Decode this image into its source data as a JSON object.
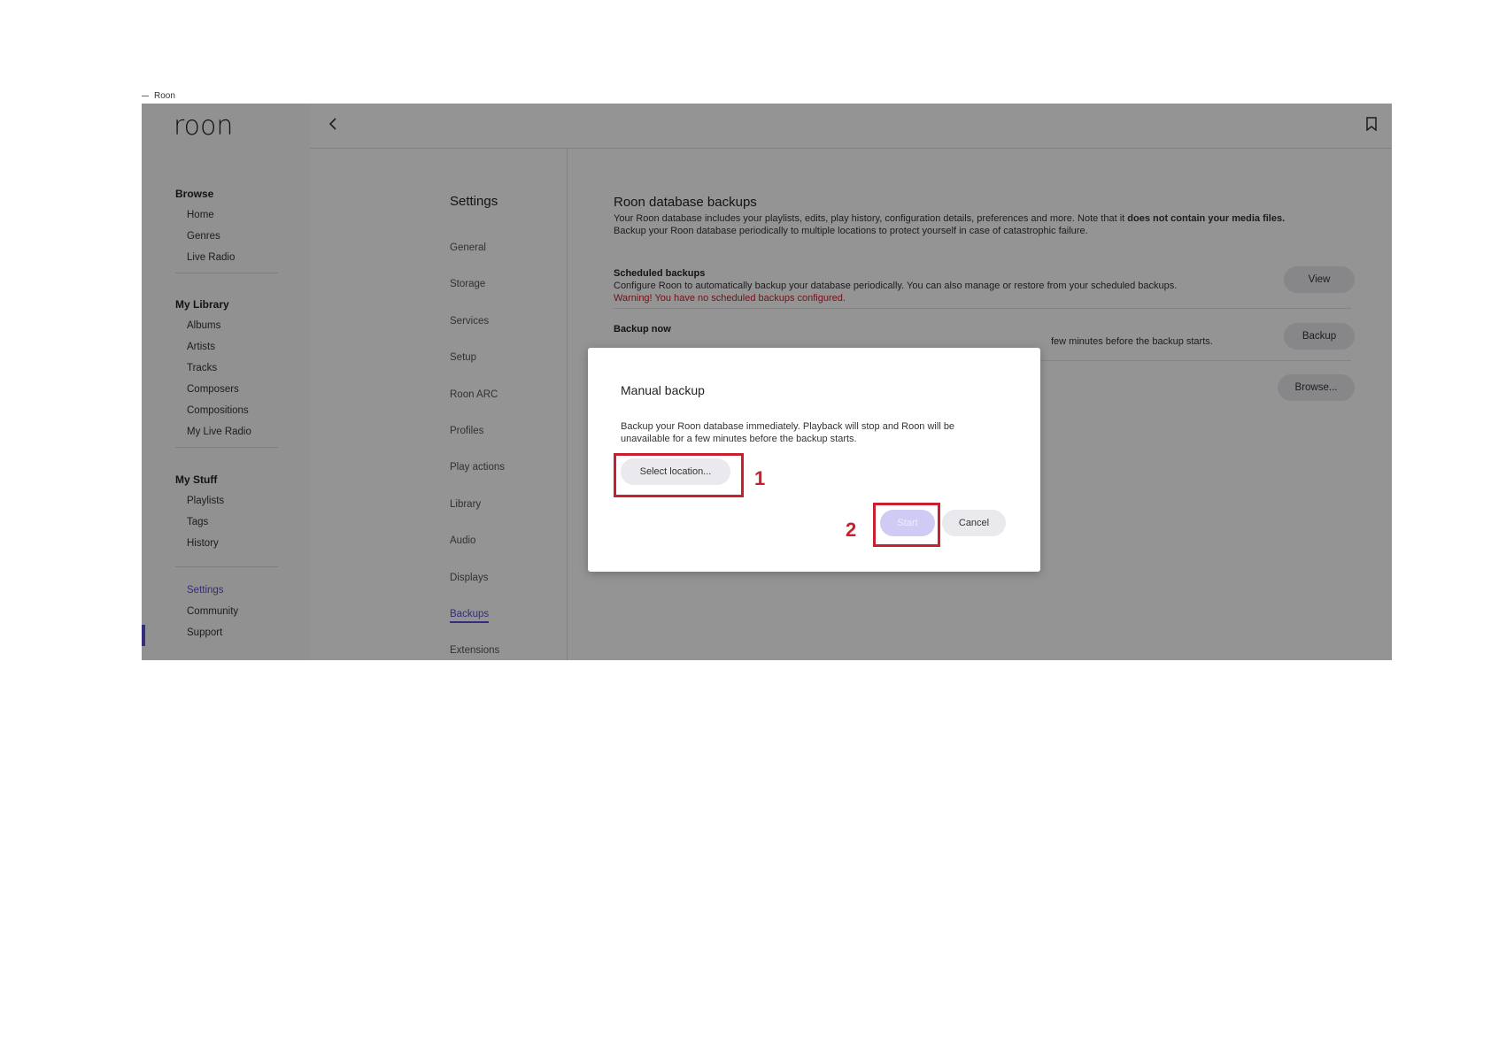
{
  "window": {
    "title": "Roon"
  },
  "brand": {
    "logo_text": "roon"
  },
  "colors": {
    "accent": "#5a4fd6",
    "warning": "#c41e2b",
    "callout": "#c8202c"
  },
  "icons": {
    "back": "chevron-left-icon",
    "bookmark": "bookmark-icon"
  },
  "sidebar": {
    "browse": {
      "label": "Browse",
      "items": [
        "Home",
        "Genres",
        "Live Radio"
      ]
    },
    "library": {
      "label": "My Library",
      "items": [
        "Albums",
        "Artists",
        "Tracks",
        "Composers",
        "Compositions",
        "My Live Radio"
      ]
    },
    "stuff": {
      "label": "My Stuff",
      "items": [
        "Playlists",
        "Tags",
        "History"
      ]
    },
    "bottom": {
      "items": [
        "Settings",
        "Community",
        "Support"
      ],
      "active": "Settings"
    }
  },
  "settings": {
    "title": "Settings",
    "items": [
      "General",
      "Storage",
      "Services",
      "Setup",
      "Roon ARC",
      "Profiles",
      "Play actions",
      "Library",
      "Audio",
      "Displays",
      "Backups",
      "Extensions"
    ],
    "active": "Backups"
  },
  "content": {
    "title": "Roon database backups",
    "desc_1": "Your Roon database includes your playlists, edits, play history, configuration details, preferences and more. Note that it ",
    "desc_bold": "does not contain your media files.",
    "desc_2": "Backup your Roon database periodically to multiple locations to protect yourself in case of catastrophic failure.",
    "scheduled": {
      "title": "Scheduled backups",
      "desc": "Configure Roon to automatically backup your database periodically. You can also manage or restore from your scheduled backups.",
      "warning": "Warning! You have no scheduled backups configured.",
      "button": "View"
    },
    "backup_now": {
      "title": "Backup now",
      "desc_visible": "few minutes before the backup starts.",
      "button": "Backup"
    },
    "browse_button": "Browse..."
  },
  "dialog": {
    "title": "Manual backup",
    "desc": "Backup your Roon database immediately. Playback will stop and Roon will be unavailable for a few minutes before the backup starts.",
    "select_location": "Select location...",
    "start": "Start",
    "cancel": "Cancel"
  },
  "callouts": {
    "one": "1",
    "two": "2"
  }
}
